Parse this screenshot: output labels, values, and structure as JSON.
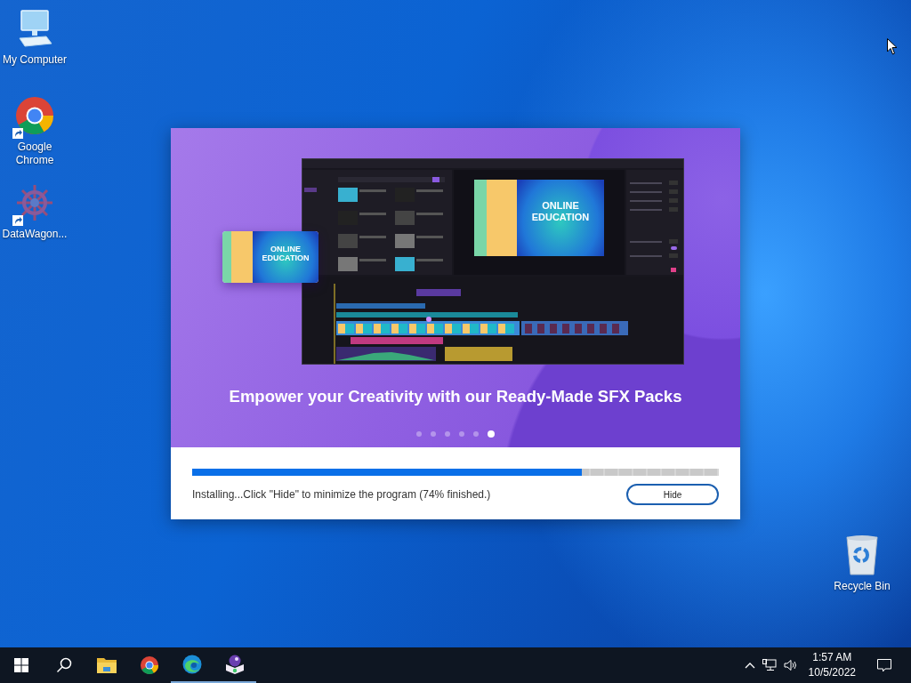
{
  "desktop_icons": [
    {
      "label": "My Computer",
      "kind": "computer",
      "shortcut": false
    },
    {
      "label": "Google Chrome",
      "kind": "chrome",
      "shortcut": true
    },
    {
      "label": "DataWagon...",
      "kind": "datawagon",
      "shortcut": true
    },
    {
      "label": "Recycle Bin",
      "kind": "recycle",
      "shortcut": false
    }
  ],
  "installer": {
    "preview": {
      "video_title": "ONLINE EDUCATION",
      "card_title": "ONLINE EDUCATION"
    },
    "headline": "Empower your Creativity with our Ready-Made SFX Packs",
    "slides": [
      {
        "selected": false
      },
      {
        "selected": false
      },
      {
        "selected": false
      },
      {
        "selected": false
      },
      {
        "selected": false
      },
      {
        "selected": true
      }
    ],
    "progress": {
      "level": 0.74
    },
    "status": "Installing...Click \"Hide\" to minimize the program (74% finished.)",
    "buttons": [
      "Hide"
    ]
  },
  "taskbar": {
    "items": [
      {
        "kind": "start",
        "running": false
      },
      {
        "kind": "search",
        "running": false
      },
      {
        "kind": "explorer",
        "running": false
      },
      {
        "kind": "chrome",
        "running": false
      },
      {
        "kind": "edge",
        "running": true
      },
      {
        "kind": "installer",
        "running": true
      }
    ],
    "time": "1:57 AM",
    "date": "10/5/2022"
  }
}
